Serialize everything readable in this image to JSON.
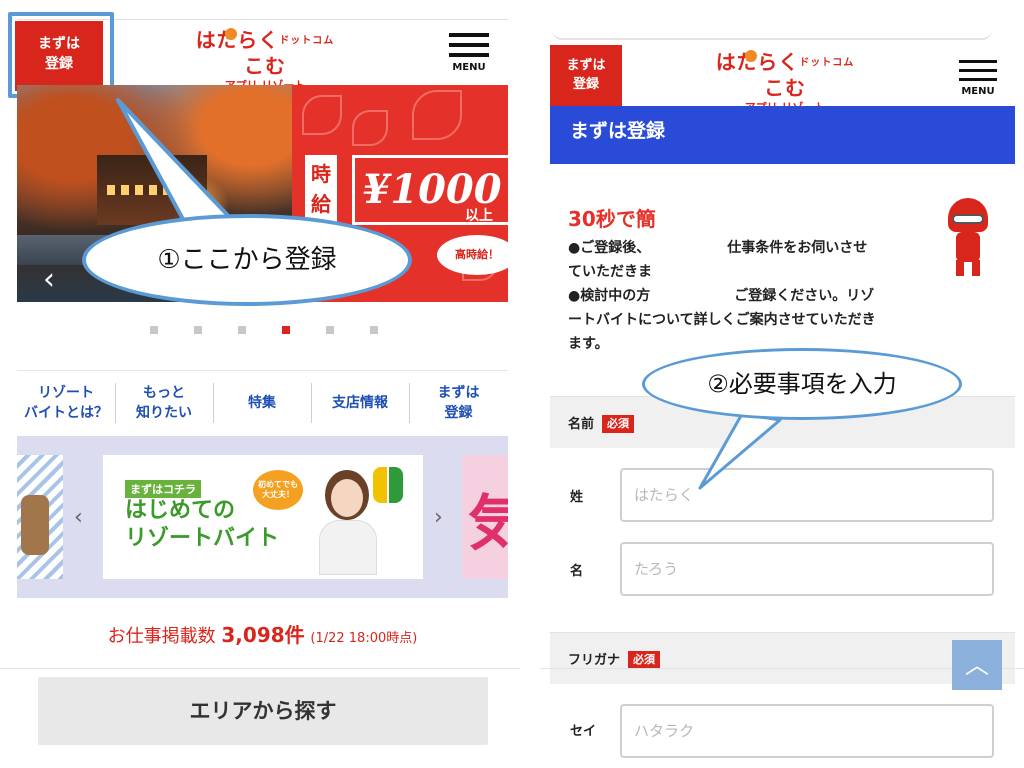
{
  "left": {
    "register_button": [
      "まずは",
      "登録"
    ],
    "logo": {
      "main": "はたらく",
      "small": "ドットコム",
      "main2": "こむ",
      "sub": "アプリ リゾート"
    },
    "menu_label": "MENU",
    "hero": {
      "jikyu": [
        "時",
        "給"
      ],
      "price": "¥1000",
      "ijo": "以上",
      "badge": "高時給！"
    },
    "callout": "①ここから登録",
    "carousel": {
      "count": 6,
      "active_index": 3
    },
    "nav": [
      [
        "リゾート",
        "バイトとは？"
      ],
      [
        "もっと",
        "知りたい"
      ],
      [
        "特集"
      ],
      [
        "支店情報"
      ],
      [
        "まずは",
        "登録"
      ]
    ],
    "banner": {
      "kochira": "まずはコチラ",
      "title_line1": "はじめての",
      "title_line2": "リゾートバイト",
      "bubble": [
        "初めてでも",
        "大丈夫！"
      ],
      "prev": "‹",
      "next": "›",
      "side_right_glyph": "気"
    },
    "job_count": {
      "prefix": "お仕事掲載数",
      "number": "3,098件",
      "time": "(1/22 18:00時点)"
    },
    "area_button": "エリアから探す"
  },
  "right": {
    "register_button": [
      "まずは",
      "登録"
    ],
    "logo": {
      "main": "はたらく",
      "small": "ドットコム",
      "main2": "こむ",
      "sub": "アプリ リゾート"
    },
    "menu_label": "MENU",
    "page_title": "まずは登録",
    "intro_head": "30秒で簡",
    "intro_lines": [
      "●ご登録後、　　　　　　仕事条件をお伺いさせ",
      "ていただきま",
      "●検討中の方　　　　　　ご登録ください。リゾ",
      "ートバイトについて詳しくご案内させていただき",
      "ます。"
    ],
    "callout": "②必要事項を入力",
    "sections": {
      "name": {
        "label": "名前",
        "required": "必須"
      },
      "furigana": {
        "label": "フリガナ",
        "required": "必須"
      }
    },
    "fields": {
      "sei": {
        "label": "姓",
        "placeholder": "はたらく"
      },
      "mei": {
        "label": "名",
        "placeholder": "たろう"
      },
      "sei_kana": {
        "label": "セイ",
        "placeholder": "ハタラク"
      }
    },
    "to_top": "︿"
  },
  "colors": {
    "brand_red": "#d9261c",
    "title_blue": "#2a4bd7",
    "nav_blue": "#1f4fb5",
    "callout_border": "#5b9bd5"
  }
}
